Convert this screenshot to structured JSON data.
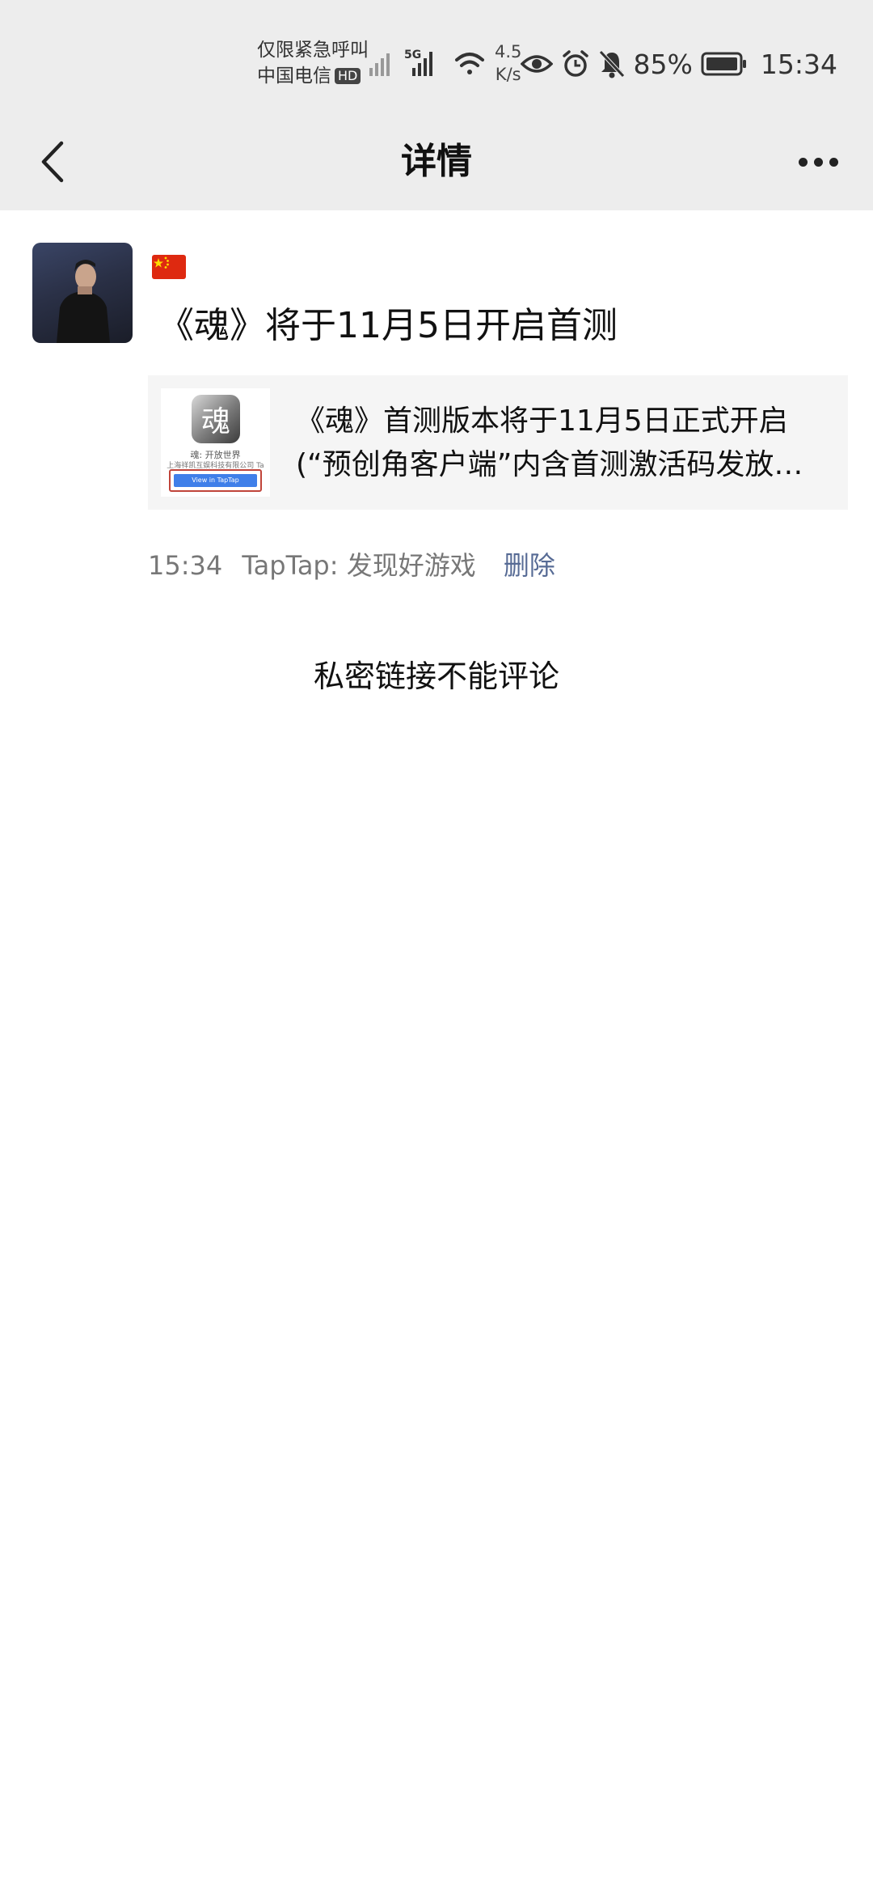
{
  "status_bar": {
    "carrier_line1": "仅限紧急呼叫",
    "carrier_line2": "中国电信",
    "hd_badge": "HD",
    "net_type": "5G",
    "speed_value": "4.5",
    "speed_unit": "K/s",
    "battery": "85%",
    "time": "15:34"
  },
  "nav": {
    "title": "详情"
  },
  "post": {
    "text": "《魂》将于11月5日开启首测",
    "link": {
      "title_line1": "《魂》首测版本将于11月5日正式开启",
      "title_line2": "(“预创角客户端”内含首测激活码发放…",
      "thumb_icon_char": "魂",
      "thumb_line1": "魂: 开放世界",
      "thumb_line2": "上海祥凯互娱科技有限公司 Ta",
      "thumb_button": "View in TapTap"
    },
    "time": "15:34",
    "source": "TapTap: 发现好游戏",
    "delete_label": "删除"
  },
  "comment_notice": "私密链接不能评论"
}
